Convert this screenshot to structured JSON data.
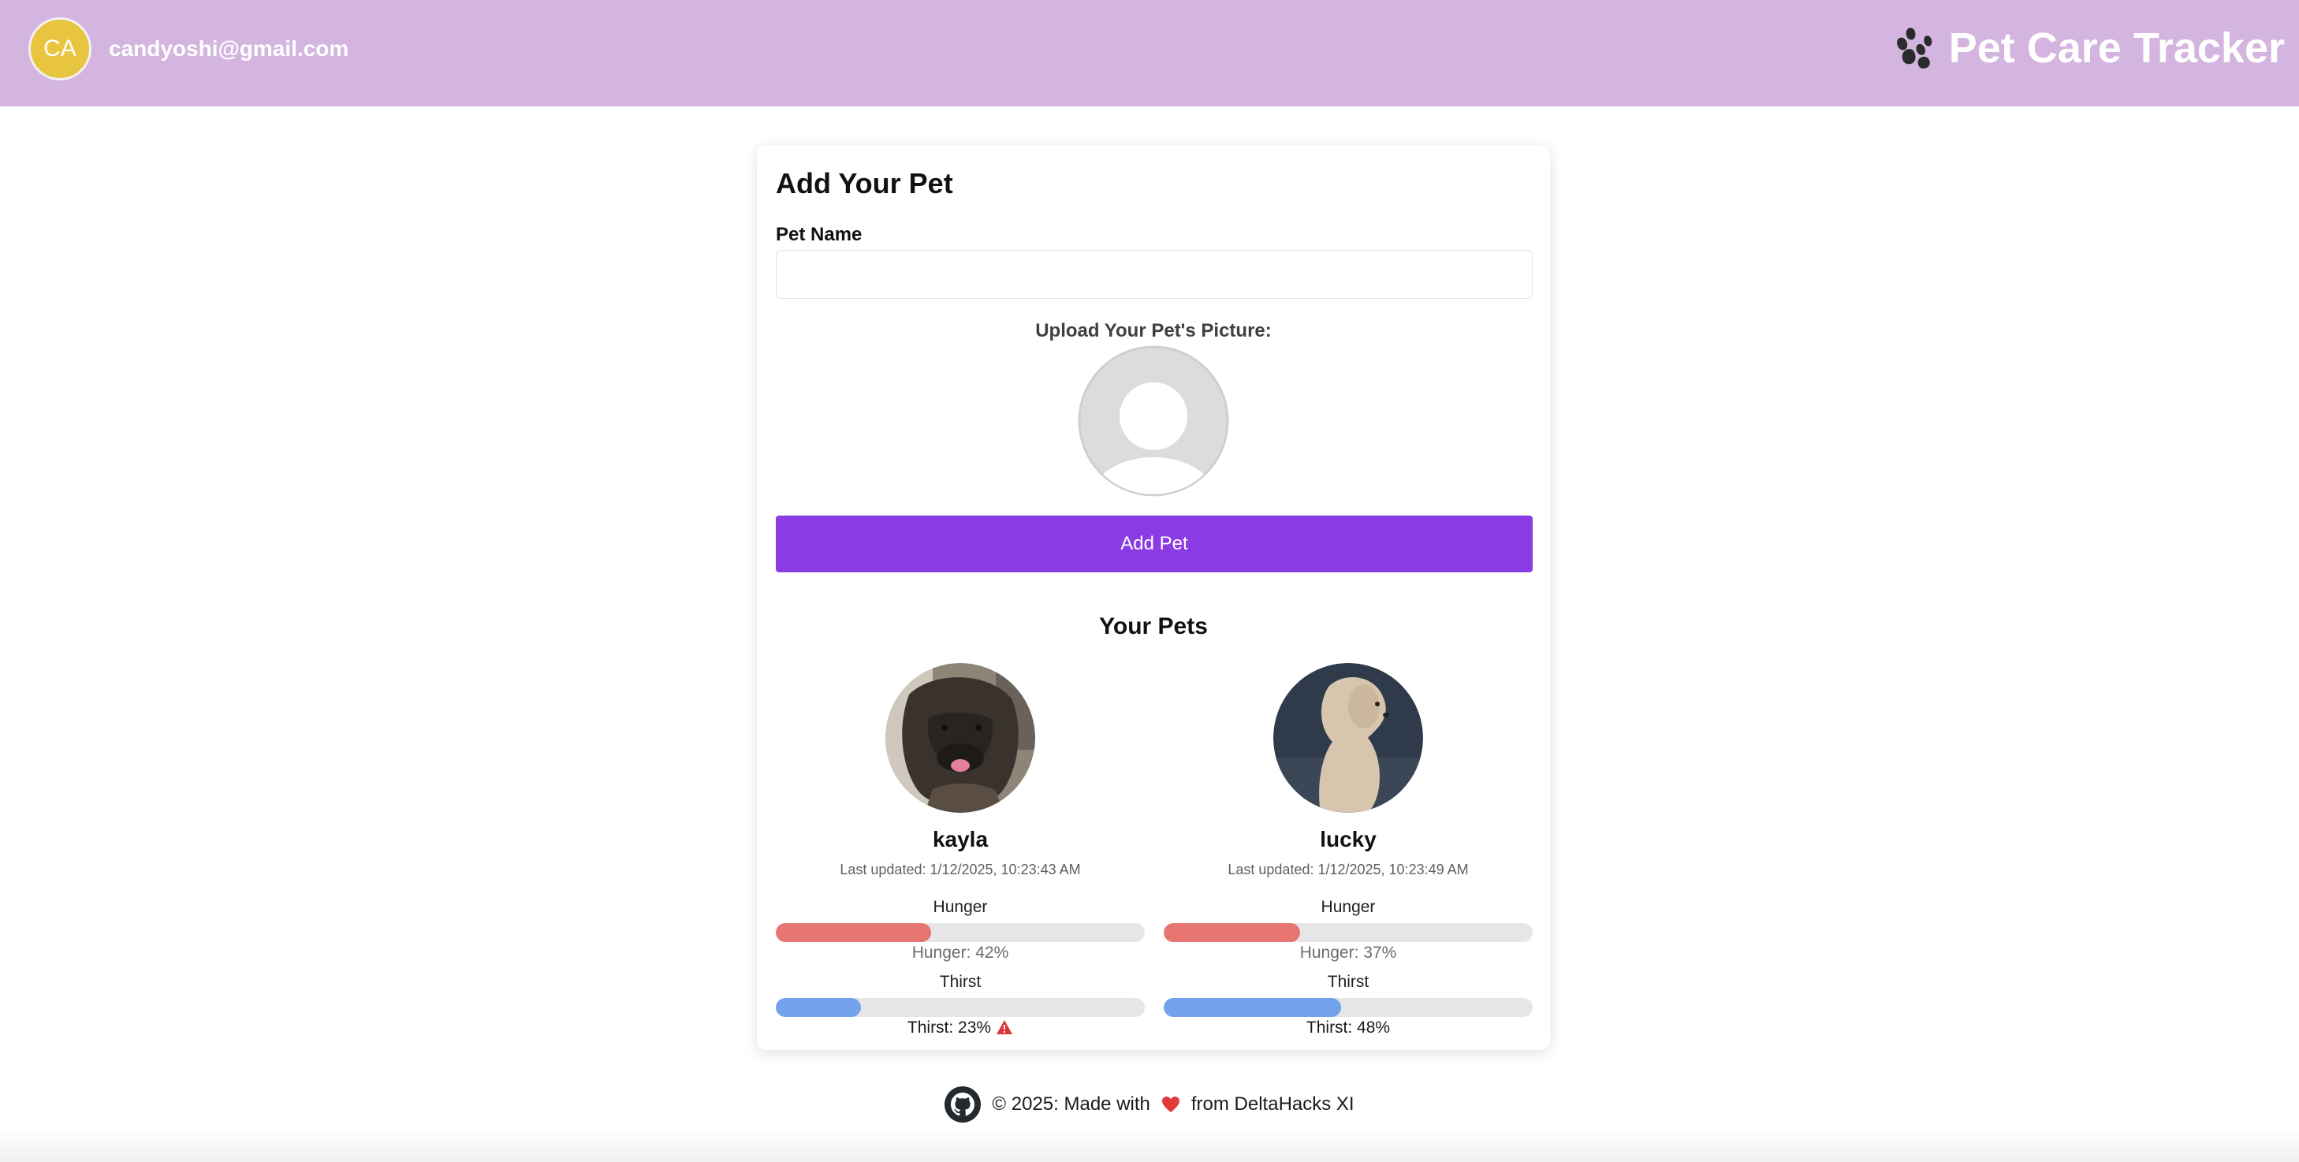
{
  "header": {
    "avatar_initials": "CA",
    "user_email": "candyoshi@gmail.com",
    "app_title": "Pet Care Tracker",
    "logo_icon": "paw-icon",
    "background_color": "#d3b5df"
  },
  "form": {
    "title": "Add Your Pet",
    "pet_name_label": "Pet Name",
    "pet_name_value": "",
    "upload_label": "Upload Your Pet's Picture:",
    "add_button_label": "Add Pet",
    "accent_color": "#8a3be3"
  },
  "pets_section": {
    "heading": "Your Pets",
    "pets": [
      {
        "name": "kayla",
        "last_updated": "Last updated: 1/12/2025, 10:23:43 AM",
        "hunger_label": "Hunger",
        "hunger_percent": 42,
        "hunger_text": "Hunger: 42%",
        "thirst_label": "Thirst",
        "thirst_percent": 23,
        "thirst_text": "Thirst: 23%",
        "thirst_warning": true
      },
      {
        "name": "lucky",
        "last_updated": "Last updated: 1/12/2025, 10:23:49 AM",
        "hunger_label": "Hunger",
        "hunger_percent": 37,
        "hunger_text": "Hunger: 37%",
        "thirst_label": "Thirst",
        "thirst_percent": 48,
        "thirst_text": "Thirst: 48%",
        "thirst_warning": false
      }
    ]
  },
  "footer": {
    "text_before": "© 2025: Made with",
    "text_after": "from DeltaHacks XI",
    "icon": "github-icon"
  }
}
